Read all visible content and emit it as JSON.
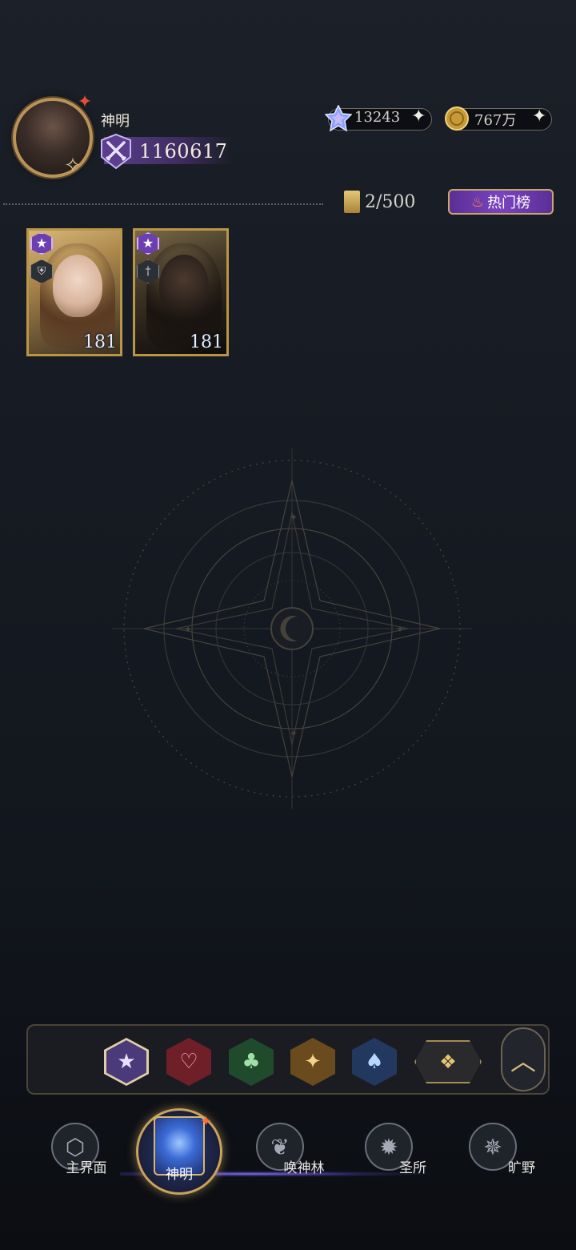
{
  "header": {
    "username": "神明",
    "power": "1160617"
  },
  "resources": {
    "gems": "13243",
    "gold": "767万",
    "plus_symbol": "+"
  },
  "collection": {
    "count": "2/500",
    "hot_button_label": "热门榜"
  },
  "heroes": [
    {
      "level": "181",
      "rank_icon": "star-icon",
      "class_icon": "shield-icon"
    },
    {
      "level": "181",
      "rank_icon": "star-icon",
      "class_icon": "sword-icon"
    }
  ],
  "filters": [
    {
      "icon": "star-icon",
      "selected": true
    },
    {
      "icon": "heart-icon"
    },
    {
      "icon": "club-icon"
    },
    {
      "icon": "diamond-icon"
    },
    {
      "icon": "spade-icon"
    },
    {
      "icon": "grid-icon"
    },
    {
      "icon": "chevron-up-icon"
    }
  ],
  "nav": {
    "items": [
      {
        "label": "主界面",
        "icon": "home-icon"
      },
      {
        "label": "神明",
        "icon": "book-icon",
        "active": true
      },
      {
        "label": "唤神林",
        "icon": "tree-icon"
      },
      {
        "label": "圣所",
        "icon": "sanctuary-icon"
      },
      {
        "label": "旷野",
        "icon": "compass-icon"
      }
    ]
  },
  "colors": {
    "accent_gold": "#b99546",
    "accent_purple": "#6b3fb1",
    "background": "#171b23"
  }
}
